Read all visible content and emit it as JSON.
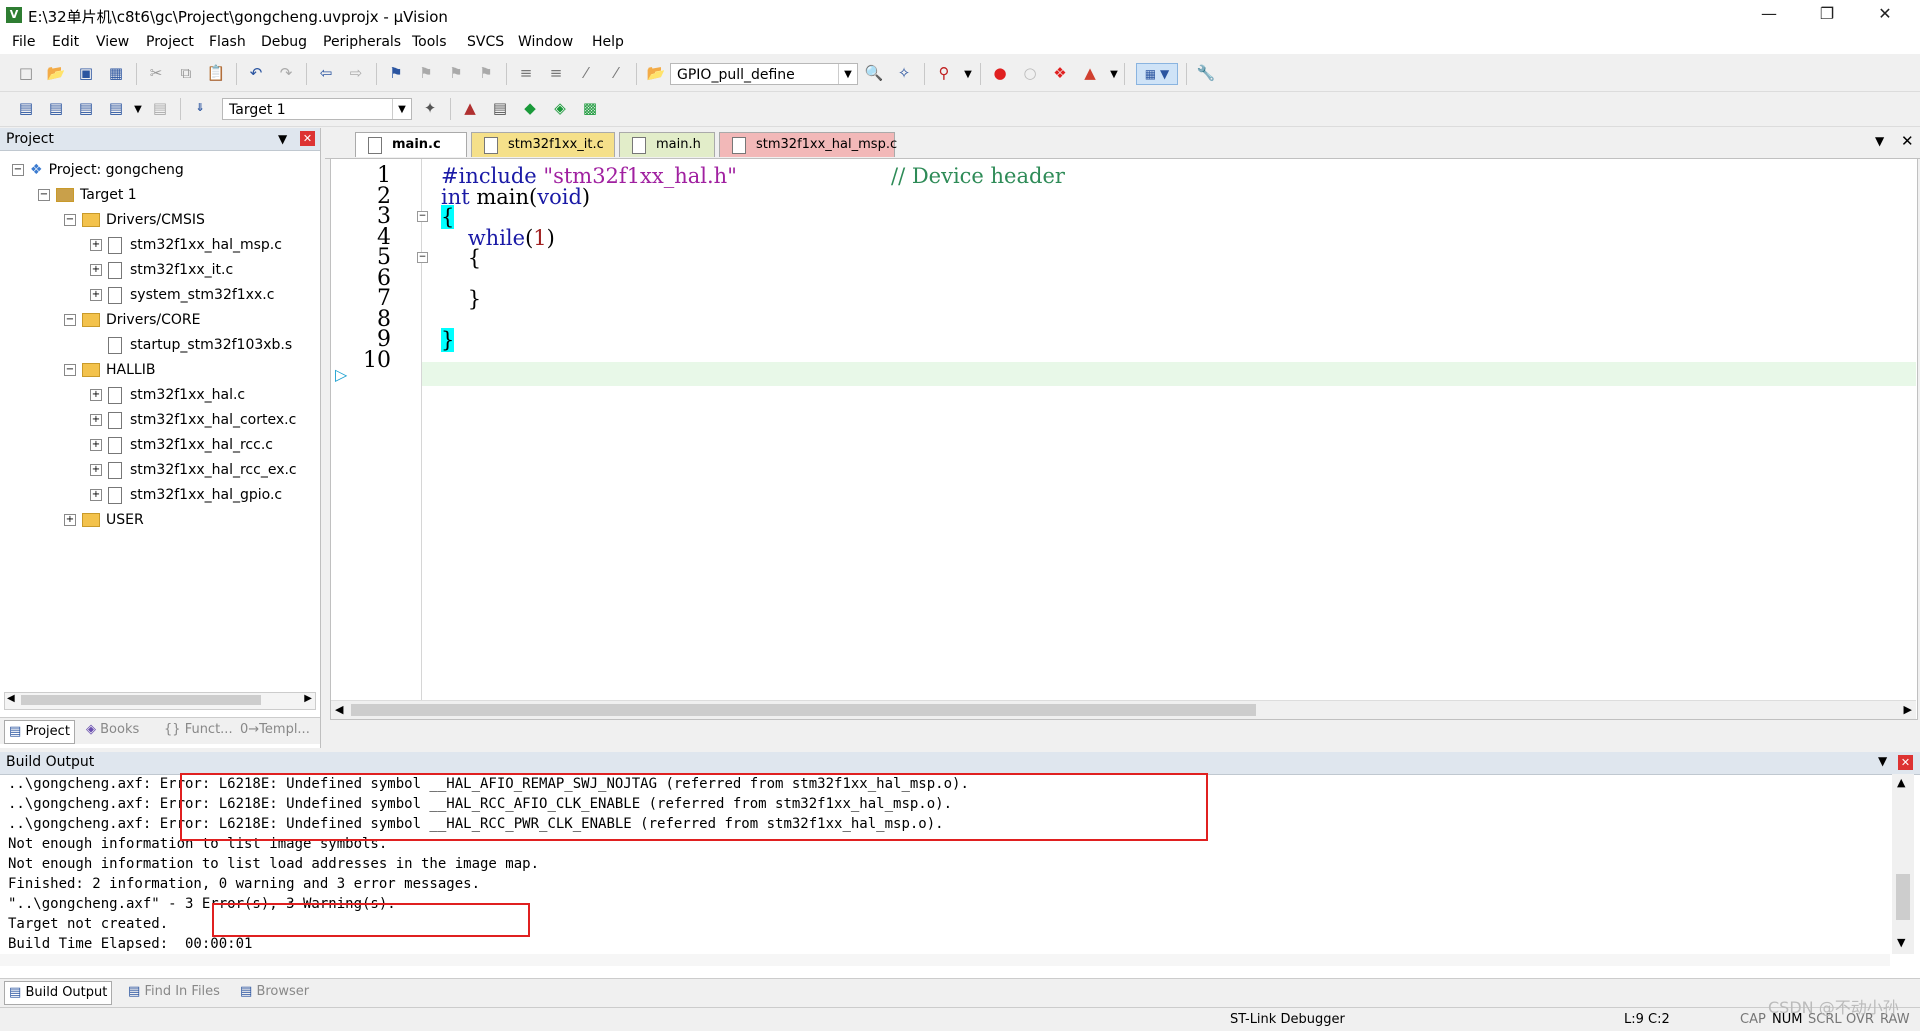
{
  "window": {
    "title": "E:\\32单片机\\c8t6\\gc\\Project\\gongcheng.uvprojx - µVision",
    "app_icon": "V"
  },
  "menu": [
    "File",
    "Edit",
    "View",
    "Project",
    "Flash",
    "Debug",
    "Peripherals",
    "Tools",
    "SVCS",
    "Window",
    "Help"
  ],
  "toolbar1": {
    "define_combo": "GPIO_pull_define"
  },
  "toolbar2": {
    "target_combo": "Target 1"
  },
  "project_panel": {
    "title": "Project",
    "tree": [
      {
        "label": "Project: gongcheng",
        "kind": "project",
        "level": 0
      },
      {
        "label": "Target 1",
        "kind": "target",
        "level": 1
      },
      {
        "label": "Drivers/CMSIS",
        "kind": "folder",
        "level": 2
      },
      {
        "label": "stm32f1xx_hal_msp.c",
        "kind": "file",
        "level": 3
      },
      {
        "label": "stm32f1xx_it.c",
        "kind": "file",
        "level": 3
      },
      {
        "label": "system_stm32f1xx.c",
        "kind": "file",
        "level": 3
      },
      {
        "label": "Drivers/CORE",
        "kind": "folder",
        "level": 2
      },
      {
        "label": "startup_stm32f103xb.s",
        "kind": "file-noexp",
        "level": 3
      },
      {
        "label": "HALLIB",
        "kind": "folder",
        "level": 2
      },
      {
        "label": "stm32f1xx_hal.c",
        "kind": "file",
        "level": 3
      },
      {
        "label": "stm32f1xx_hal_cortex.c",
        "kind": "file",
        "level": 3
      },
      {
        "label": "stm32f1xx_hal_rcc.c",
        "kind": "file",
        "level": 3
      },
      {
        "label": "stm32f1xx_hal_rcc_ex.c",
        "kind": "file",
        "level": 3
      },
      {
        "label": "stm32f1xx_hal_gpio.c",
        "kind": "file",
        "level": 3
      },
      {
        "label": "USER",
        "kind": "folder-collapsed",
        "level": 2
      }
    ],
    "bottom_tabs": [
      "Project",
      "Books",
      "Funct...",
      "Templ..."
    ]
  },
  "editor": {
    "tabs": [
      {
        "label": "main.c",
        "active": true,
        "color": "#ffffff"
      },
      {
        "label": "stm32f1xx_it.c",
        "active": false,
        "color": "#f5e08a"
      },
      {
        "label": "main.h",
        "active": false,
        "color": "#e2edc9"
      },
      {
        "label": "stm32f1xx_hal_msp.c",
        "active": false,
        "color": "#f2b8b8"
      }
    ],
    "lines": [
      {
        "n": "1",
        "text": "#include \"stm32f1xx_hal.h\"",
        "comment": "// Device header"
      },
      {
        "n": "2",
        "text": "int main(void)"
      },
      {
        "n": "3",
        "text": "{"
      },
      {
        "n": "4",
        "text": "    while(1)"
      },
      {
        "n": "5",
        "text": "    {"
      },
      {
        "n": "6",
        "text": ""
      },
      {
        "n": "7",
        "text": "    }"
      },
      {
        "n": "8",
        "text": ""
      },
      {
        "n": "9",
        "text": "}"
      },
      {
        "n": "10",
        "text": ""
      }
    ]
  },
  "build_output": {
    "title": "Build Output",
    "lines": [
      "..\\gongcheng.axf: Error: L6218E: Undefined symbol __HAL_AFIO_REMAP_SWJ_NOJTAG (referred from stm32f1xx_hal_msp.o).",
      "..\\gongcheng.axf: Error: L6218E: Undefined symbol __HAL_RCC_AFIO_CLK_ENABLE (referred from stm32f1xx_hal_msp.o).",
      "..\\gongcheng.axf: Error: L6218E: Undefined symbol __HAL_RCC_PWR_CLK_ENABLE (referred from stm32f1xx_hal_msp.o).",
      "Not enough information to list image symbols.",
      "Not enough information to list load addresses in the image map.",
      "Finished: 2 information, 0 warning and 3 error messages.",
      "\"..\\gongcheng.axf\" - 3 Error(s), 3 Warning(s).",
      "Target not created.",
      "Build Time Elapsed:  00:00:01"
    ],
    "bottom_tabs": [
      "Build Output",
      "Find In Files",
      "Browser"
    ]
  },
  "status": {
    "debugger": "ST-Link Debugger",
    "position": "L:9 C:2",
    "flags": [
      "CAP",
      "NUM",
      "SCRL",
      "OVR",
      "RAW"
    ],
    "watermark": "CSDN @不动小孙"
  },
  "colors": {
    "error_box": "#e02020",
    "keyword": "#1a1aa6",
    "string": "#a020a0",
    "comment": "#2e8b57",
    "current_line": "#e8f8e8",
    "cursor_brace": "#00ffff"
  }
}
